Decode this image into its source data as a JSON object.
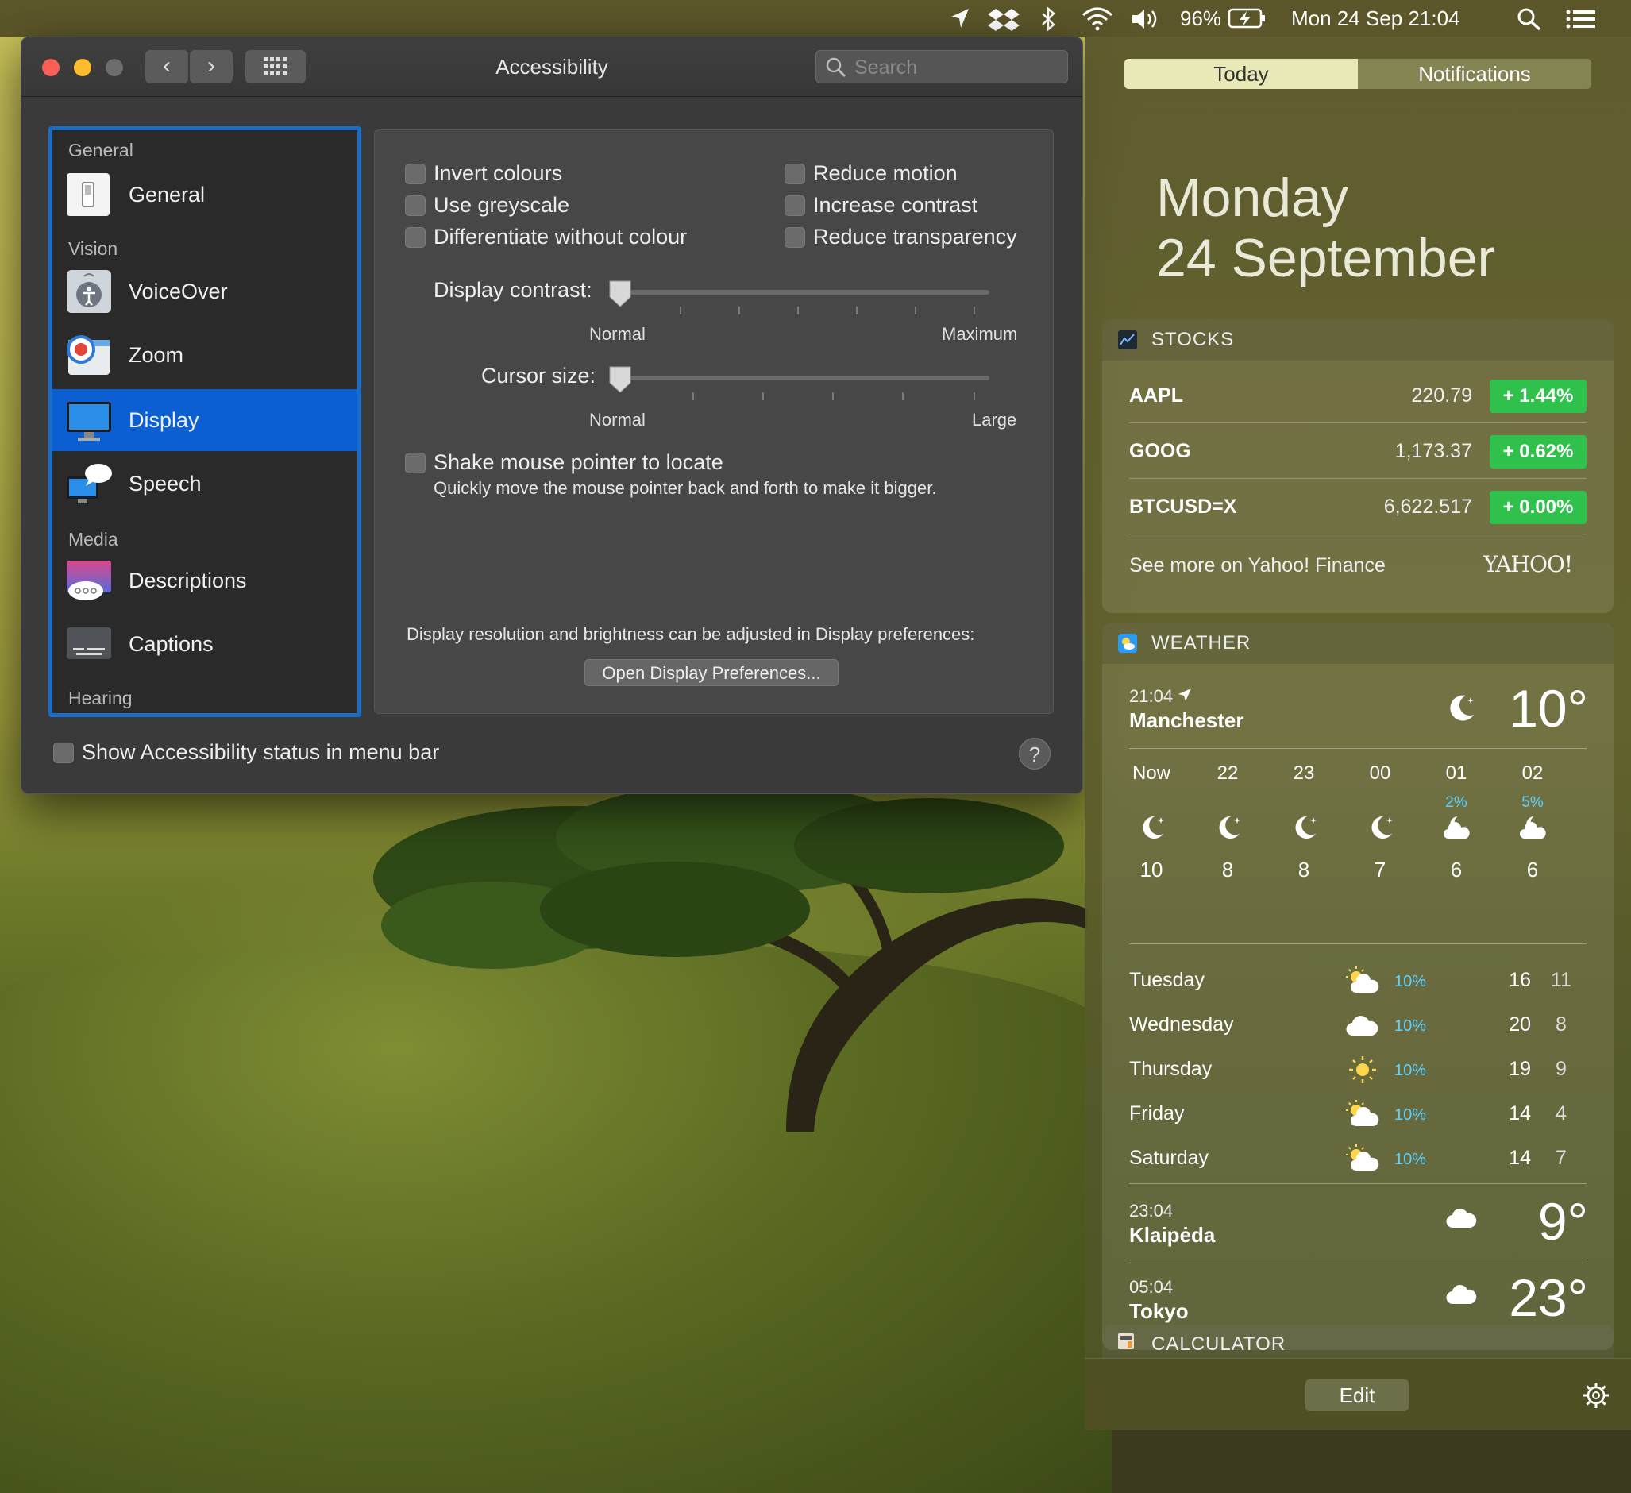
{
  "menubar": {
    "battery_percent": "96%",
    "datetime": "Mon 24 Sep  21:04",
    "icons": [
      "location-icon",
      "dropbox-icon",
      "bluetooth-icon",
      "wifi-icon",
      "volume-icon",
      "battery-charging-icon",
      "spotlight-search-icon",
      "notification-center-icon"
    ]
  },
  "window": {
    "title": "Accessibility",
    "search_placeholder": "Search",
    "nav": {
      "back": "‹",
      "forward": "›",
      "grid": "⠿"
    }
  },
  "sidebar": {
    "headers": {
      "general": "General",
      "vision": "Vision",
      "media": "Media",
      "hearing": "Hearing"
    },
    "items": [
      {
        "label": "General"
      },
      {
        "label": "VoiceOver"
      },
      {
        "label": "Zoom"
      },
      {
        "label": "Display",
        "selected": true
      },
      {
        "label": "Speech"
      },
      {
        "label": "Descriptions"
      },
      {
        "label": "Captions"
      }
    ]
  },
  "display": {
    "checkboxes_left": [
      "Invert colours",
      "Use greyscale",
      "Differentiate without colour"
    ],
    "checkboxes_right": [
      "Reduce motion",
      "Increase contrast",
      "Reduce transparency"
    ],
    "contrast": {
      "label": "Display contrast:",
      "min_label": "Normal",
      "max_label": "Maximum",
      "value": 0
    },
    "cursor": {
      "label": "Cursor size:",
      "min_label": "Normal",
      "max_label": "Large",
      "value": 0
    },
    "shake": {
      "label": "Shake mouse pointer to locate",
      "description": "Quickly move the mouse pointer back and forth to make it bigger."
    },
    "footer_text": "Display resolution and brightness can be adjusted in Display preferences:",
    "open_button": "Open Display Preferences..."
  },
  "status_checkbox": "Show Accessibility status in menu bar",
  "help_button": "?",
  "notification_center": {
    "tabs": {
      "today": "Today",
      "notifications": "Notifications"
    },
    "date_line1": "Monday",
    "date_line2": "24 September",
    "stocks": {
      "title": "STOCKS",
      "rows": [
        {
          "symbol": "AAPL",
          "price": "220.79",
          "change": "+ 1.44%"
        },
        {
          "symbol": "GOOG",
          "price": "1,173.37",
          "change": "+ 0.62%"
        },
        {
          "symbol": "BTCUSD=X",
          "price": "6,622.517",
          "change": "+ 0.00%"
        }
      ],
      "more_link": "See more on Yahoo! Finance",
      "logo": "YAHOO!"
    },
    "weather": {
      "title": "WEATHER",
      "current": {
        "time": "21:04",
        "city": "Manchester",
        "temp": "10°"
      },
      "hourly": [
        {
          "hour": "Now",
          "pct": "",
          "temp": "10",
          "icon": "moon"
        },
        {
          "hour": "22",
          "pct": "",
          "temp": "8",
          "icon": "moon"
        },
        {
          "hour": "23",
          "pct": "",
          "temp": "8",
          "icon": "moon"
        },
        {
          "hour": "00",
          "pct": "",
          "temp": "7",
          "icon": "moon"
        },
        {
          "hour": "01",
          "pct": "2%",
          "temp": "6",
          "icon": "moon-cloud"
        },
        {
          "hour": "02",
          "pct": "5%",
          "temp": "6",
          "icon": "moon-cloud"
        }
      ],
      "daily": [
        {
          "day": "Tuesday",
          "pct": "10%",
          "hi": "16",
          "lo": "11",
          "icon": "sun-cloud"
        },
        {
          "day": "Wednesday",
          "pct": "10%",
          "hi": "20",
          "lo": "8",
          "icon": "cloud"
        },
        {
          "day": "Thursday",
          "pct": "10%",
          "hi": "19",
          "lo": "9",
          "icon": "sun"
        },
        {
          "day": "Friday",
          "pct": "10%",
          "hi": "14",
          "lo": "4",
          "icon": "sun-cloud"
        },
        {
          "day": "Saturday",
          "pct": "10%",
          "hi": "14",
          "lo": "7",
          "icon": "sun-cloud"
        }
      ],
      "other_cities": [
        {
          "time": "23:04",
          "city": "Klaipėda",
          "temp": "9°"
        },
        {
          "time": "05:04",
          "city": "Tokyo",
          "temp": "23°"
        }
      ]
    },
    "calculator_title": "CALCULATOR",
    "edit_button": "Edit"
  }
}
